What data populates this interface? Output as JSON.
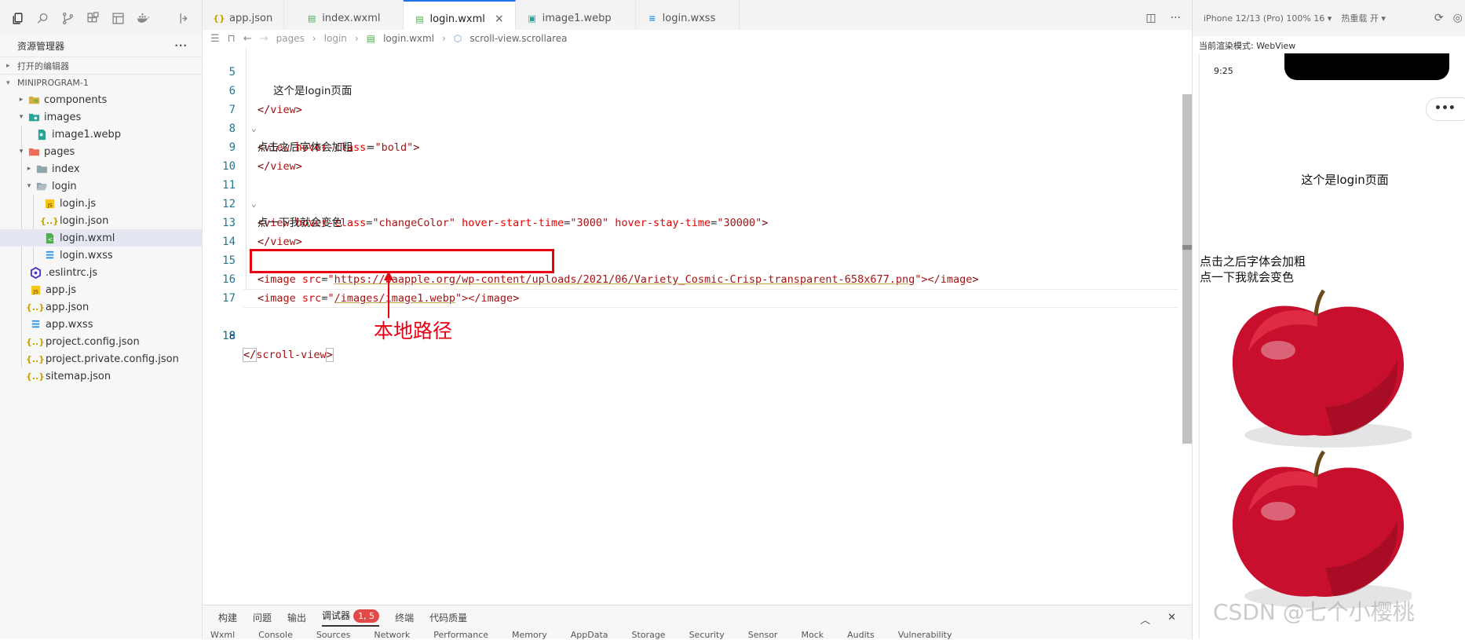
{
  "activity_bar": {
    "icons": [
      "files-icon",
      "search-icon",
      "source-control-icon",
      "extensions-icon",
      "layout-icon",
      "docker-icon",
      "split-icon"
    ]
  },
  "explorer": {
    "title": "资源管理器",
    "more": "···",
    "open_editors": "打开的编辑器",
    "project": "MINIPROGRAM-1",
    "items": [
      {
        "label": "components",
        "kind": "folder"
      },
      {
        "label": "images",
        "kind": "folder"
      },
      {
        "label": "image1.webp",
        "kind": "image"
      },
      {
        "label": "pages",
        "kind": "folder"
      },
      {
        "label": "index",
        "kind": "folder"
      },
      {
        "label": "login",
        "kind": "folder"
      },
      {
        "label": "login.js",
        "kind": "js"
      },
      {
        "label": "login.json",
        "kind": "json"
      },
      {
        "label": "login.wxml",
        "kind": "wxml"
      },
      {
        "label": "login.wxss",
        "kind": "wxss"
      },
      {
        "label": ".eslintrc.js",
        "kind": "eslint"
      },
      {
        "label": "app.js",
        "kind": "js"
      },
      {
        "label": "app.json",
        "kind": "json"
      },
      {
        "label": "app.wxss",
        "kind": "wxss"
      },
      {
        "label": "project.config.json",
        "kind": "json"
      },
      {
        "label": "project.private.config.json",
        "kind": "json"
      },
      {
        "label": "sitemap.json",
        "kind": "json"
      }
    ]
  },
  "tabs": [
    {
      "label": "app.json"
    },
    {
      "label": "index.wxml"
    },
    {
      "label": "login.wxml",
      "close": "×"
    },
    {
      "label": "image1.webp"
    },
    {
      "label": "login.wxss"
    }
  ],
  "tabs_actions": {
    "split": "◫",
    "more": "···"
  },
  "breadcrumb": {
    "pages": "pages",
    "login": "login",
    "file": "login.wxml",
    "node": "scroll-view.scrollarea"
  },
  "code": {
    "l5": {
      "num": "5",
      "text": "这个是login页面"
    },
    "l6": {
      "num": "6",
      "close": "</",
      "tag": "view",
      "end": ">"
    },
    "l7": {
      "num": "7",
      "open": "<",
      "tag": "view",
      "attr": "hover-class",
      "eq": "=",
      "val": "\"bold\"",
      "end": ">"
    },
    "l8": {
      "num": "8",
      "text": "点击之后字体会加粗"
    },
    "l9": {
      "num": "9",
      "close": "</",
      "tag": "view",
      "end": ">"
    },
    "l10": {
      "num": "10"
    },
    "l11": {
      "num": "11",
      "open": "<",
      "tag": "view",
      "attr1": "hover-class",
      "val1": "\"changeColor\"",
      "attr2": "hover-start-time",
      "val2": "\"3000\"",
      "attr3": "hover-stay-time",
      "val3": "\"30000\"",
      "end": ">"
    },
    "l12": {
      "num": "12",
      "text": "点一下我就会变色"
    },
    "l13": {
      "num": "13",
      "close": "</",
      "tag": "view",
      "end": ">"
    },
    "l14": {
      "num": "14"
    },
    "l15": {
      "num": "15",
      "open": "<",
      "tag": "image",
      "attr": "src",
      "q": "\"",
      "url": "https://waapple.org/wp-content/uploads/2021/06/Variety_Cosmic-Crisp-transparent-658x677.png",
      "tail": "\"></",
      "tag2": "image",
      "end": ">"
    },
    "l16": {
      "num": "16",
      "open": "<",
      "tag": "image",
      "attr": "src",
      "q": "\"",
      "path": "/images/image1.webp",
      "tail": "\"></",
      "tag2": "image",
      "end": ">"
    },
    "l17": {
      "num": "17"
    },
    "l18": {
      "num": "18",
      "close": "</",
      "tag": "scroll-view",
      "end": ">"
    },
    "l19": {
      "num": "19"
    }
  },
  "annotation": {
    "text": "本地路径",
    "color": "#e60012"
  },
  "panel": {
    "tabs": [
      "构建",
      "问题",
      "输出",
      "调试器",
      "终端",
      "代码质量"
    ],
    "badge": "1, 5",
    "sub_tabs": [
      "Wxml",
      "Console",
      "Sources",
      "Network",
      "Performance",
      "Memory",
      "AppData",
      "Storage",
      "Security",
      "Sensor",
      "Mock",
      "Audits",
      "Vulnerability"
    ],
    "collapse": "︿",
    "close": "✕"
  },
  "simulator": {
    "device": "iPhone 12/13 (Pro) 100% 16 ▾",
    "hot_reload": "热重载 开 ▾",
    "render_mode": "当前渲染模式: WebView",
    "time": "9:25",
    "time_cut": "9:",
    "capsule": "•••",
    "page_text": "这个是login页面",
    "line1": "点击之后字体会加粗",
    "line2": "点一下我就会变色"
  },
  "watermark": "CSDN @七个小樱桃",
  "colors": {
    "accent": "#1a73e8",
    "annotation": "#e60012",
    "apple": "#c8102e"
  }
}
